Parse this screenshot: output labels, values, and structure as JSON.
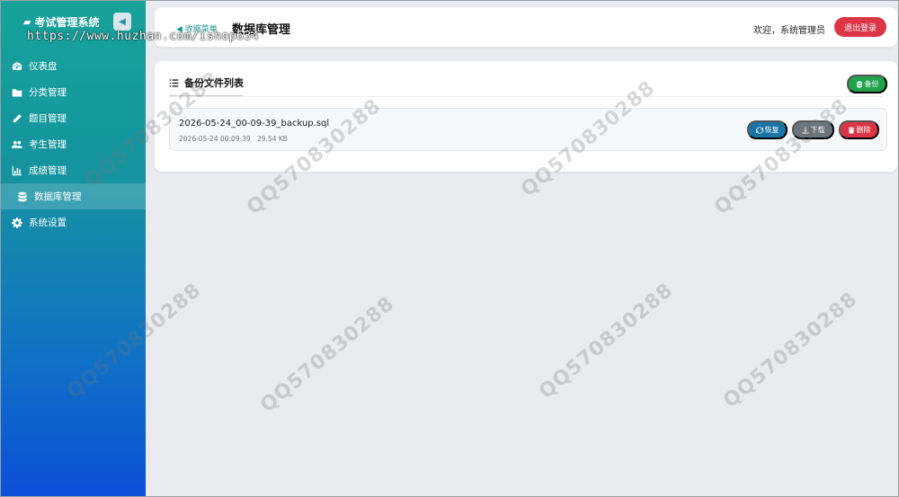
{
  "app": {
    "title": "考试管理系统"
  },
  "watermark": {
    "url": "https://www.huzhan.com/ishop634",
    "qq": "QQ570830288"
  },
  "sidebar": {
    "items": [
      {
        "label": "仪表盘",
        "icon": "dashboard-icon"
      },
      {
        "label": "分类管理",
        "icon": "folder-icon"
      },
      {
        "label": "题目管理",
        "icon": "pencil-icon"
      },
      {
        "label": "考生管理",
        "icon": "users-icon"
      },
      {
        "label": "成绩管理",
        "icon": "bar-chart-icon"
      },
      {
        "label": "数据库管理",
        "icon": "database-icon",
        "active": true
      },
      {
        "label": "系统设置",
        "icon": "gear-icon"
      }
    ]
  },
  "header": {
    "shrink_label": "◀ 收缩菜单",
    "page_title": "数据库管理",
    "welcome": "欢迎，系统管理员",
    "logout_label": "退出登录"
  },
  "card": {
    "title": "备份文件列表",
    "backup_label": "备份",
    "files": [
      {
        "name": "2026-05-24_00-09-39_backup.sql",
        "date": "2026-05-24 00:09:39",
        "size": "29.54 KB",
        "restore_label": "恢复",
        "download_label": "下载",
        "delete_label": "删除"
      }
    ]
  },
  "colors": {
    "accent": "#16a39a",
    "danger": "#dc3545",
    "success": "#1fa24a",
    "info": "#1a74a8",
    "secondary": "#6c757d"
  }
}
